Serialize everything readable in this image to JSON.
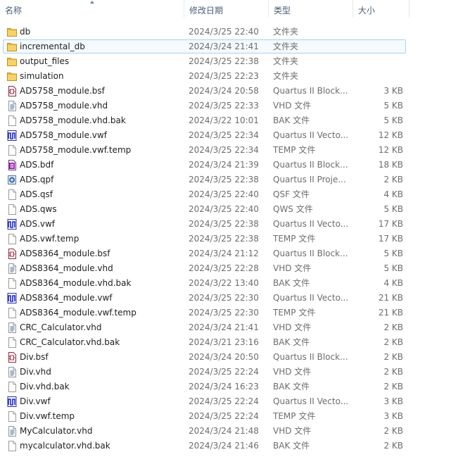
{
  "columns": {
    "name": "名称",
    "date": "修改日期",
    "type": "类型",
    "size": "大小"
  },
  "files": [
    {
      "name": "db",
      "date": "2024/3/25 22:40",
      "type": "文件夹",
      "size": "",
      "icon": "folder-icon"
    },
    {
      "name": "incremental_db",
      "date": "2024/3/24 21:41",
      "type": "文件夹",
      "size": "",
      "icon": "folder-icon",
      "selected": true
    },
    {
      "name": "output_files",
      "date": "2024/3/25 22:38",
      "type": "文件夹",
      "size": "",
      "icon": "folder-icon"
    },
    {
      "name": "simulation",
      "date": "2024/3/25 22:23",
      "type": "文件夹",
      "size": "",
      "icon": "folder-icon"
    },
    {
      "name": "AD5758_module.bsf",
      "date": "2024/3/24 20:58",
      "type": "Quartus II Block...",
      "size": "3 KB",
      "icon": "block-symbol-file-icon"
    },
    {
      "name": "AD5758_module.vhd",
      "date": "2024/3/25 22:33",
      "type": "VHD 文件",
      "size": "5 KB",
      "icon": "text-document-icon"
    },
    {
      "name": "AD5758_module.vhd.bak",
      "date": "2024/3/22 10:01",
      "type": "BAK 文件",
      "size": "5 KB",
      "icon": "blank-file-icon"
    },
    {
      "name": "AD5758_module.vwf",
      "date": "2024/3/25 22:34",
      "type": "Quartus II Vecto...",
      "size": "12 KB",
      "icon": "waveform-file-icon"
    },
    {
      "name": "AD5758_module.vwf.temp",
      "date": "2024/3/25 22:34",
      "type": "TEMP 文件",
      "size": "12 KB",
      "icon": "blank-file-icon"
    },
    {
      "name": "ADS.bdf",
      "date": "2024/3/24 21:39",
      "type": "Quartus II Block...",
      "size": "18 KB",
      "icon": "block-diagram-file-icon"
    },
    {
      "name": "ADS.qpf",
      "date": "2024/3/25 22:38",
      "type": "Quartus II Proje...",
      "size": "2 KB",
      "icon": "project-file-icon"
    },
    {
      "name": "ADS.qsf",
      "date": "2024/3/25 22:40",
      "type": "QSF 文件",
      "size": "4 KB",
      "icon": "blank-file-icon"
    },
    {
      "name": "ADS.qws",
      "date": "2024/3/25 22:40",
      "type": "QWS 文件",
      "size": "5 KB",
      "icon": "blank-file-icon"
    },
    {
      "name": "ADS.vwf",
      "date": "2024/3/25 22:38",
      "type": "Quartus II Vecto...",
      "size": "17 KB",
      "icon": "waveform-file-icon"
    },
    {
      "name": "ADS.vwf.temp",
      "date": "2024/3/25 22:38",
      "type": "TEMP 文件",
      "size": "17 KB",
      "icon": "blank-file-icon"
    },
    {
      "name": "ADS8364_module.bsf",
      "date": "2024/3/24 21:12",
      "type": "Quartus II Block...",
      "size": "5 KB",
      "icon": "block-symbol-file-icon"
    },
    {
      "name": "ADS8364_module.vhd",
      "date": "2024/3/25 22:28",
      "type": "VHD 文件",
      "size": "5 KB",
      "icon": "text-document-icon"
    },
    {
      "name": "ADS8364_module.vhd.bak",
      "date": "2024/3/22 13:40",
      "type": "BAK 文件",
      "size": "4 KB",
      "icon": "blank-file-icon"
    },
    {
      "name": "ADS8364_module.vwf",
      "date": "2024/3/25 22:30",
      "type": "Quartus II Vecto...",
      "size": "21 KB",
      "icon": "waveform-file-icon"
    },
    {
      "name": "ADS8364_module.vwf.temp",
      "date": "2024/3/25 22:30",
      "type": "TEMP 文件",
      "size": "21 KB",
      "icon": "blank-file-icon"
    },
    {
      "name": "CRC_Calculator.vhd",
      "date": "2024/3/24 21:41",
      "type": "VHD 文件",
      "size": "2 KB",
      "icon": "text-document-icon"
    },
    {
      "name": "CRC_Calculator.vhd.bak",
      "date": "2024/3/21 23:16",
      "type": "BAK 文件",
      "size": "2 KB",
      "icon": "blank-file-icon"
    },
    {
      "name": "Div.bsf",
      "date": "2024/3/24 20:50",
      "type": "Quartus II Block...",
      "size": "2 KB",
      "icon": "block-symbol-file-icon"
    },
    {
      "name": "Div.vhd",
      "date": "2024/3/25 22:24",
      "type": "VHD 文件",
      "size": "2 KB",
      "icon": "text-document-icon"
    },
    {
      "name": "Div.vhd.bak",
      "date": "2024/3/24 16:23",
      "type": "BAK 文件",
      "size": "2 KB",
      "icon": "blank-file-icon"
    },
    {
      "name": "Div.vwf",
      "date": "2024/3/25 22:24",
      "type": "Quartus II Vecto...",
      "size": "3 KB",
      "icon": "waveform-file-icon"
    },
    {
      "name": "Div.vwf.temp",
      "date": "2024/3/25 22:24",
      "type": "TEMP 文件",
      "size": "3 KB",
      "icon": "blank-file-icon"
    },
    {
      "name": "MyCalculator.vhd",
      "date": "2024/3/24 21:48",
      "type": "VHD 文件",
      "size": "2 KB",
      "icon": "text-document-icon"
    },
    {
      "name": "mycalculator.vhd.bak",
      "date": "2024/3/24 21:46",
      "type": "BAK 文件",
      "size": "2 KB",
      "icon": "blank-file-icon"
    }
  ]
}
